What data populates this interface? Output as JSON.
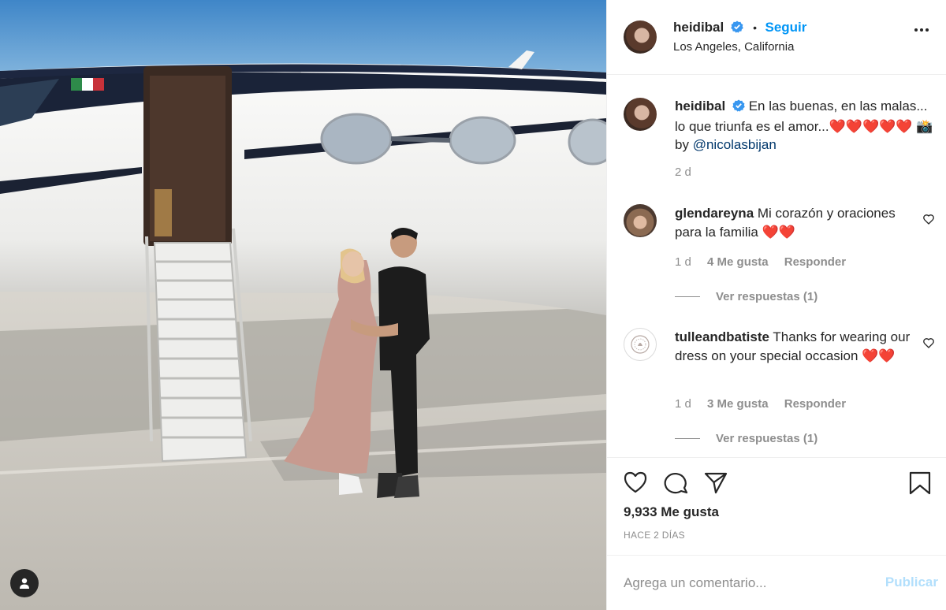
{
  "post": {
    "username": "heidibal",
    "follow_label": "Seguir",
    "separator": "•",
    "location": "Los Angeles, California",
    "more_icon": "more-horizontal-icon"
  },
  "caption": {
    "username": "heidibal",
    "text": "En las buenas, en las malas... lo que triunfa es el amor...❤️❤️❤️❤️❤️ 📸 by",
    "mention": "@nicolasbijan",
    "time": "2 d"
  },
  "comments": [
    {
      "username": "glendareyna",
      "text": "Mi corazón y oraciones para la familia ❤️❤️",
      "time": "1 d",
      "likes": "4 Me gusta",
      "reply_label": "Responder",
      "view_replies": "Ver respuestas (1)"
    },
    {
      "username": "tulleandbatiste",
      "text": "Thanks for wearing our dress on your special occasion ❤️❤️",
      "time": "1 d",
      "likes": "3 Me gusta",
      "reply_label": "Responder",
      "view_replies": "Ver respuestas (1)"
    }
  ],
  "stats": {
    "likes": "9,933 Me gusta",
    "posted_ago": "HACE 2 DÍAS"
  },
  "comment_box": {
    "placeholder": "Agrega un comentario...",
    "publish_label": "Publicar"
  },
  "colors": {
    "accent": "#0095f6",
    "publish_disabled": "#b2dffc",
    "text": "#262626",
    "muted": "#8e8e8e"
  }
}
